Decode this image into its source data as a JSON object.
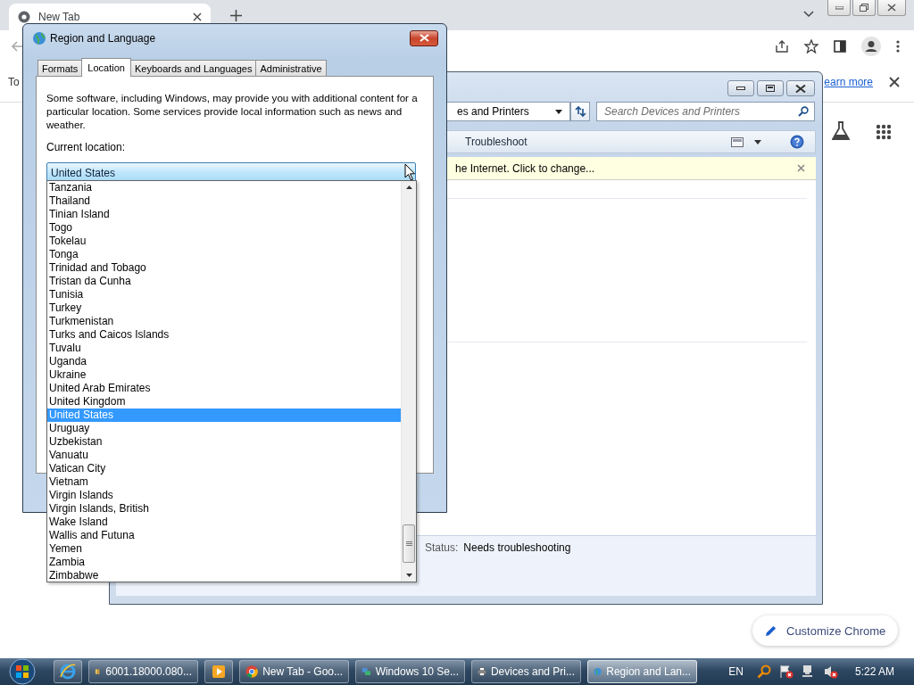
{
  "browser": {
    "tab": {
      "title": "New Tab"
    },
    "info_bar": {
      "text": "To",
      "link": "earn more"
    },
    "customize_button": "Customize Chrome"
  },
  "devices_window": {
    "address": "es and Printers",
    "search": {
      "placeholder": "Search Devices and Printers"
    },
    "toolbar": [
      "Troubleshoot"
    ],
    "notification": "he Internet. Click to change...",
    "details": {
      "status_label": "Status:",
      "status_value": "Needs troubleshooting"
    }
  },
  "dialog": {
    "title": "Region and Language",
    "tabs": [
      {
        "label": "Formats",
        "selected": false
      },
      {
        "label": "Location",
        "selected": true
      },
      {
        "label": "Keyboards and Languages",
        "selected": false
      },
      {
        "label": "Administrative",
        "selected": false
      }
    ],
    "description": "Some software, including Windows, may provide you with additional content for a particular location. Some services provide local information such as news and weather.",
    "location_label": "Current location:",
    "location_value": "United States",
    "options": [
      {
        "label": "Tanzania",
        "selected": false
      },
      {
        "label": "Thailand",
        "selected": false
      },
      {
        "label": "Tinian Island",
        "selected": false
      },
      {
        "label": "Togo",
        "selected": false
      },
      {
        "label": "Tokelau",
        "selected": false
      },
      {
        "label": "Tonga",
        "selected": false
      },
      {
        "label": "Trinidad and Tobago",
        "selected": false
      },
      {
        "label": "Tristan da Cunha",
        "selected": false
      },
      {
        "label": "Tunisia",
        "selected": false
      },
      {
        "label": "Turkey",
        "selected": false
      },
      {
        "label": "Turkmenistan",
        "selected": false
      },
      {
        "label": "Turks and Caicos Islands",
        "selected": false
      },
      {
        "label": "Tuvalu",
        "selected": false
      },
      {
        "label": "Uganda",
        "selected": false
      },
      {
        "label": "Ukraine",
        "selected": false
      },
      {
        "label": "United Arab Emirates",
        "selected": false
      },
      {
        "label": "United Kingdom",
        "selected": false
      },
      {
        "label": "United States",
        "selected": true
      },
      {
        "label": "Uruguay",
        "selected": false
      },
      {
        "label": "Uzbekistan",
        "selected": false
      },
      {
        "label": "Vanuatu",
        "selected": false
      },
      {
        "label": "Vatican City",
        "selected": false
      },
      {
        "label": "Vietnam",
        "selected": false
      },
      {
        "label": "Virgin Islands",
        "selected": false
      },
      {
        "label": "Virgin Islands, British",
        "selected": false
      },
      {
        "label": "Wake Island",
        "selected": false
      },
      {
        "label": "Wallis and Futuna",
        "selected": false
      },
      {
        "label": "Yemen",
        "selected": false
      },
      {
        "label": "Zambia",
        "selected": false
      },
      {
        "label": "Zimbabwe",
        "selected": false
      }
    ]
  },
  "taskbar": {
    "buttons": [
      {
        "kind": "ie",
        "selected": false
      },
      {
        "kind": "folder",
        "label": "6001.18000.080...",
        "selected": false
      },
      {
        "kind": "media",
        "selected": false
      },
      {
        "kind": "chrome",
        "label": "New Tab - Goo...",
        "selected": false
      },
      {
        "kind": "network",
        "label": "Windows 10 Se...",
        "selected": false
      },
      {
        "kind": "printer",
        "label": "Devices and Pri...",
        "selected": false
      },
      {
        "kind": "globe",
        "label": "Region and Lan...",
        "selected": true
      }
    ],
    "language": "EN",
    "clock": "5:22 AM"
  }
}
